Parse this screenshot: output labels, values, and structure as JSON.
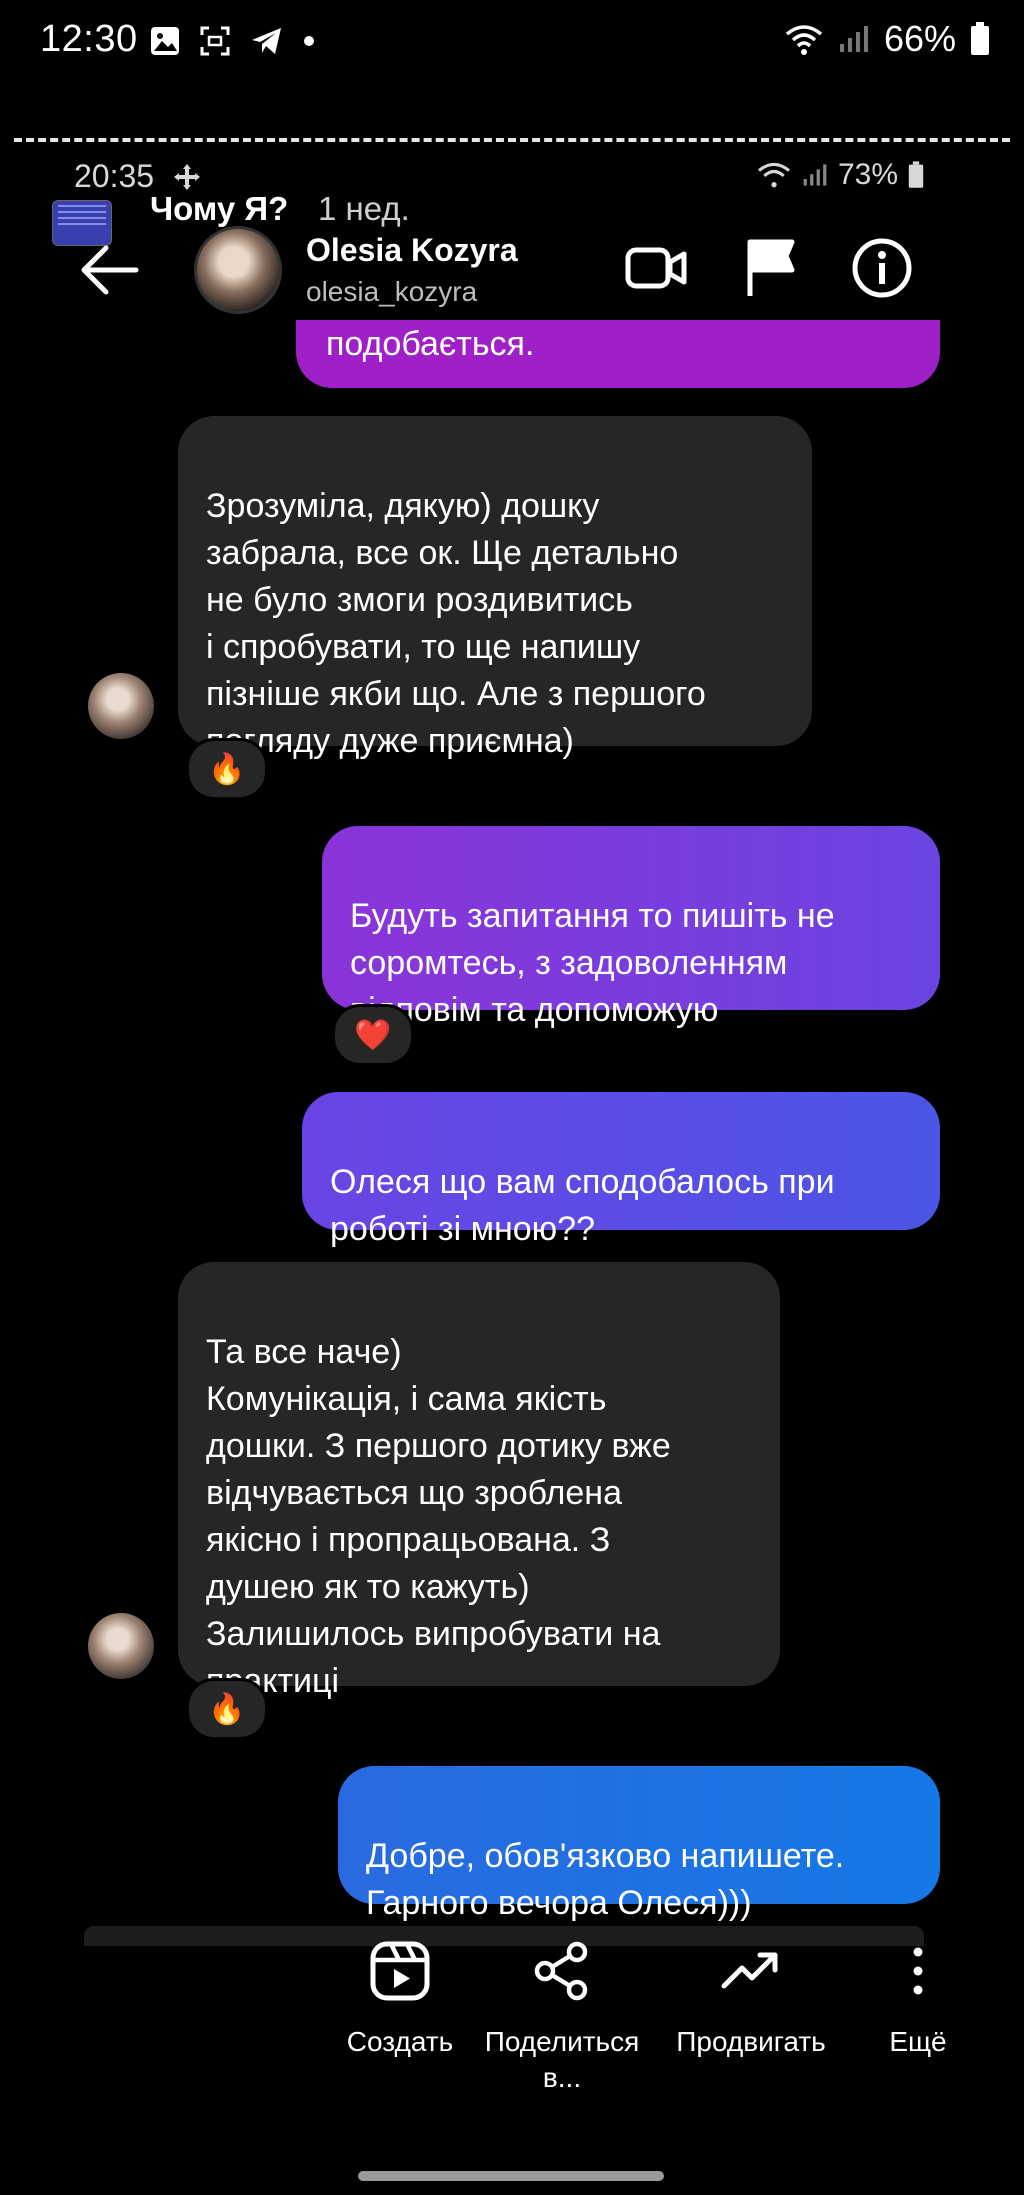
{
  "status_bar": {
    "time": "12:30",
    "battery": "66%"
  },
  "inner_status_bar": {
    "time": "20:35",
    "battery": "73%"
  },
  "story": {
    "title": "Чому Я?",
    "age": "1 нед."
  },
  "chat_header": {
    "name": "Olesia Kozyra",
    "username": "olesia_kozyra"
  },
  "messages": [
    {
      "type": "outgoing",
      "text": "подобається."
    },
    {
      "type": "incoming",
      "text": "Зрозуміла, дякую) дошку\nзабрала, все ок. Ще детально\nне було змоги роздивитись\nі спробувати, то ще напишу\nпізніше якби що. Але з першого\nпогляду дуже приємна)",
      "reaction": "🔥"
    },
    {
      "type": "outgoing",
      "text": "Будуть запитання то пишіть не\nсоромтесь, з задоволенням\nвідповім та допоможую",
      "reaction": "❤️"
    },
    {
      "type": "outgoing",
      "text": "Олеся що вам сподобалось при\nроботі зі мною??"
    },
    {
      "type": "incoming",
      "text": "Та все наче)\nКомунікація, і сама якість\nдошки. З першого дотику вже\nвідчувається що зроблена\nякісно і пропрацьована. З\nдушею як то кажуть)\nЗалишилось випробувати на\nпрактиці",
      "reaction": "🔥"
    },
    {
      "type": "outgoing",
      "text": "Добре, обов'язково напишете.\nГарного вечора Олеся)))"
    }
  ],
  "bottom_actions": [
    {
      "label": "Создать",
      "icon": "reels-icon"
    },
    {
      "label": "Поделиться\nв...",
      "icon": "share-icon"
    },
    {
      "label": "Продвигать",
      "icon": "trending-icon"
    },
    {
      "label": "Ещё",
      "icon": "more-vertical-icon"
    }
  ],
  "colors": {
    "incoming_bubble": "#262626",
    "outgoing_magenta": "#a020c8",
    "outgoing_violet": "#7a3ee0",
    "outgoing_indigo": "#5a4fe6",
    "outgoing_blue": "#1a72e8"
  }
}
